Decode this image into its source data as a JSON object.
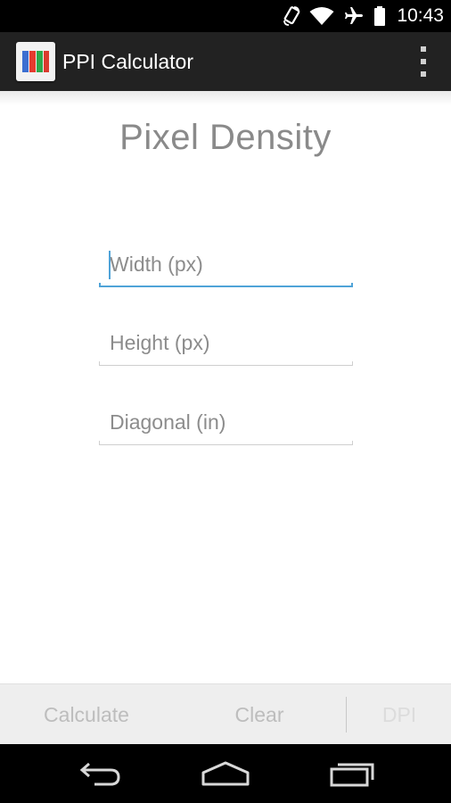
{
  "status_bar": {
    "time": "10:43",
    "icons": [
      "rotate-icon",
      "wifi-icon",
      "airplane-mode-icon",
      "battery-icon"
    ]
  },
  "action_bar": {
    "title": "PPI Calculator",
    "app_icon": "ppi-calculator-app-icon",
    "overflow_icon": "overflow-menu-icon"
  },
  "main": {
    "title": "Pixel Density",
    "fields": [
      {
        "placeholder": "Width (px)",
        "value": "",
        "focused": true
      },
      {
        "placeholder": "Height (px)",
        "value": "",
        "focused": false
      },
      {
        "placeholder": "Diagonal (in)",
        "value": "",
        "focused": false
      }
    ]
  },
  "button_bar": {
    "calculate_label": "Calculate",
    "clear_label": "Clear",
    "dpi_label": "DPI"
  },
  "nav_bar": {
    "icons": [
      "back-icon",
      "home-icon",
      "recent-apps-icon"
    ]
  },
  "colors": {
    "accent": "#4fa3d8",
    "action_bar": "#222222",
    "button_text_disabled": "#bdbdbd"
  }
}
